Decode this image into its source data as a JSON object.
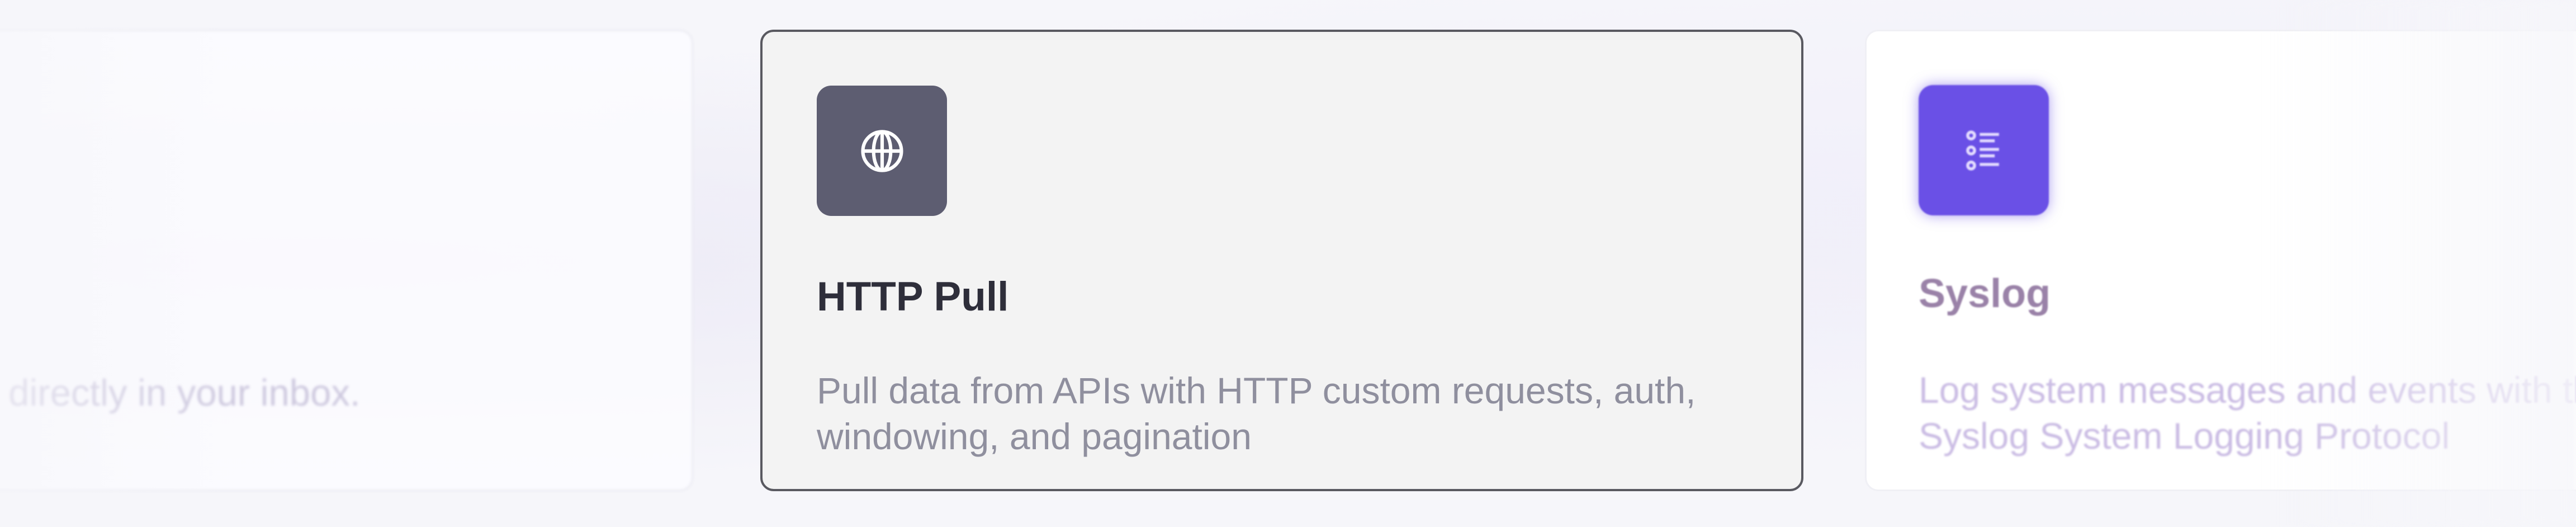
{
  "cards": [
    {
      "name": "",
      "description": "s directly in your inbox.",
      "state": "faded"
    },
    {
      "name": "HTTP Pull",
      "description": "Pull data from APIs with HTTP custom requests, auth, windowing, and pagination",
      "icon": "globe-icon",
      "icon_bg": "#5d5d71",
      "state": "selected",
      "border_color": "#595960"
    },
    {
      "name": "Syslog",
      "description": "Log system messages and events with the Syslog System Logging Protocol",
      "icon": "list-icon",
      "icon_bg": "#6a50e6",
      "state": "faded"
    }
  ]
}
